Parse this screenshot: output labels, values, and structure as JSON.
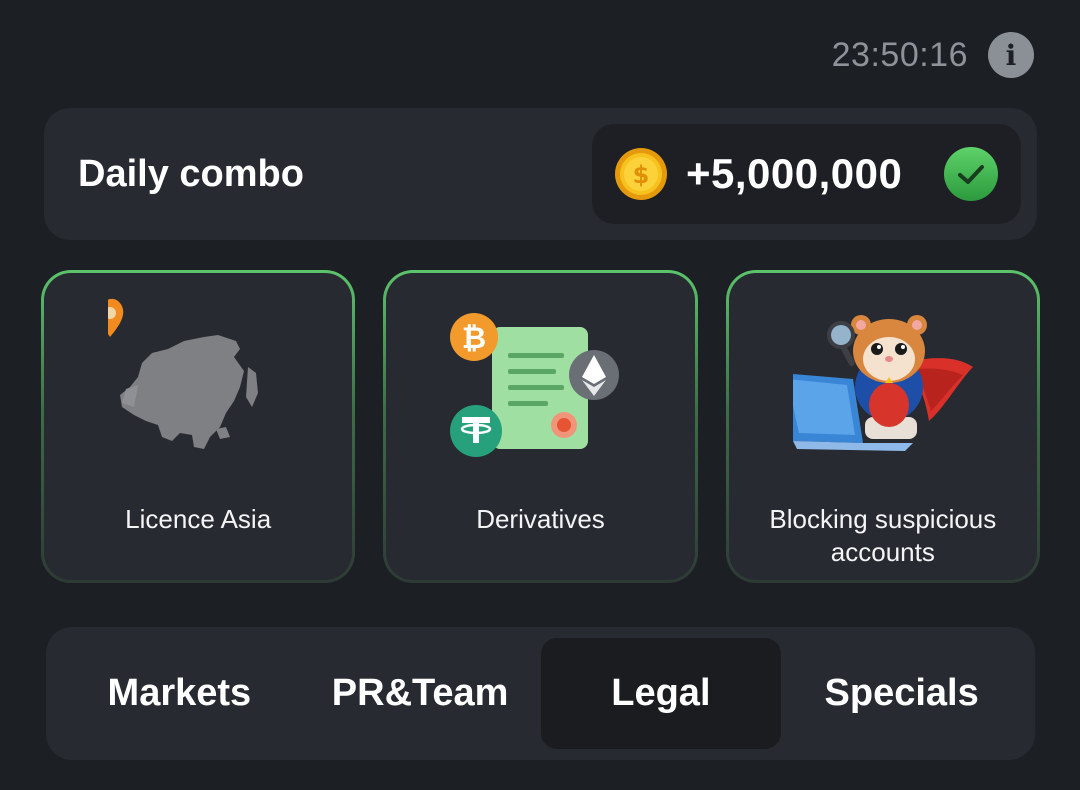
{
  "header": {
    "timer": "23:50:16",
    "info_icon": "info-icon",
    "info_glyph": "i"
  },
  "combo": {
    "title": "Daily combo",
    "reward": "+5,000,000",
    "reward_icon": "coin-icon",
    "status_icon": "check-icon",
    "colors": {
      "coin": "#f5b81c",
      "check": "#3fb54f"
    }
  },
  "cards": [
    {
      "label": "Licence Asia",
      "icon": "asia-map-icon"
    },
    {
      "label": "Derivatives",
      "icon": "crypto-document-icon"
    },
    {
      "label": "Blocking suspicious accounts",
      "icon": "hamster-detective-icon"
    }
  ],
  "tabs": [
    {
      "label": "Markets",
      "active": false
    },
    {
      "label": "PR&Team",
      "active": false
    },
    {
      "label": "Legal",
      "active": true
    },
    {
      "label": "Specials",
      "active": false
    }
  ],
  "colors": {
    "background": "#1c1f24",
    "panel": "#272a30",
    "accent_border": "#5cc46b",
    "muted_text": "#8e9299"
  }
}
